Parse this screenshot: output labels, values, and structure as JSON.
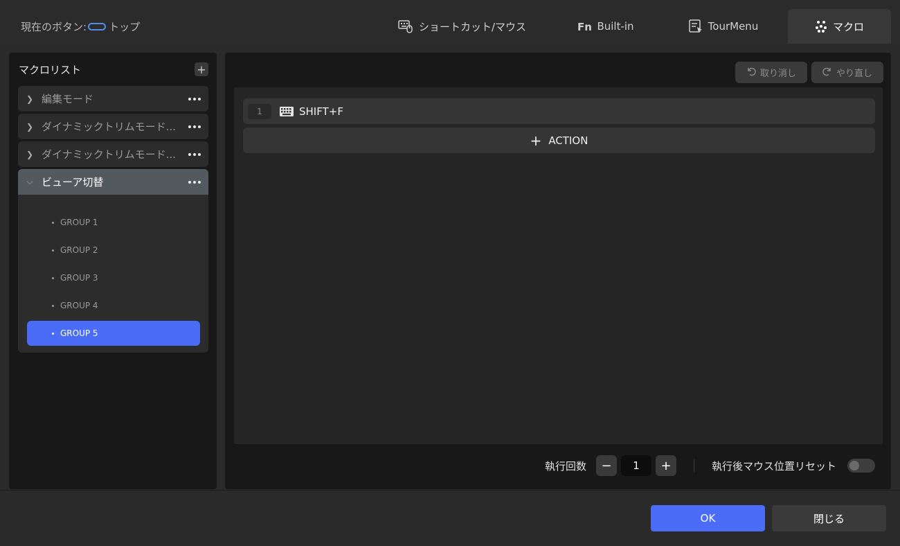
{
  "header": {
    "current_button_label": "現在のボタン:",
    "current_button_value": "トップ",
    "tabs": [
      {
        "label": "ショートカット/マウス",
        "icon": "keyboard-mouse-icon"
      },
      {
        "label": "Built-in",
        "icon": "fn-icon"
      },
      {
        "label": "TourMenu",
        "icon": "tourmenu-icon"
      },
      {
        "label": "マクロ",
        "icon": "macro-icon",
        "active": true
      }
    ]
  },
  "macro_list": {
    "title": "マクロリスト",
    "items": [
      {
        "name": "編集モード",
        "expanded": false
      },
      {
        "name": "ダイナミックトリムモード...",
        "expanded": false
      },
      {
        "name": "ダイナミックトリムモード...",
        "expanded": false
      },
      {
        "name": "ビューア切替",
        "expanded": true
      }
    ],
    "groups": [
      "GROUP 1",
      "GROUP 2",
      "GROUP 3",
      "GROUP 4",
      "GROUP 5"
    ],
    "selected_group": "GROUP 5"
  },
  "editor": {
    "undo_label": "取り消し",
    "redo_label": "やり直し",
    "actions": [
      {
        "index": "1",
        "label": "SHIFT+F",
        "icon": "keyboard-icon"
      }
    ],
    "add_action_label": "ACTION",
    "repeat_label": "執行回数",
    "repeat_value": "1",
    "reset_mouse_label": "執行後マウス位置リセット",
    "reset_mouse_enabled": false
  },
  "footer": {
    "ok_label": "OK",
    "close_label": "閉じる"
  },
  "colors": {
    "accent": "#4a6cf7",
    "background": "#2a2a2a",
    "panel": "#181818"
  }
}
